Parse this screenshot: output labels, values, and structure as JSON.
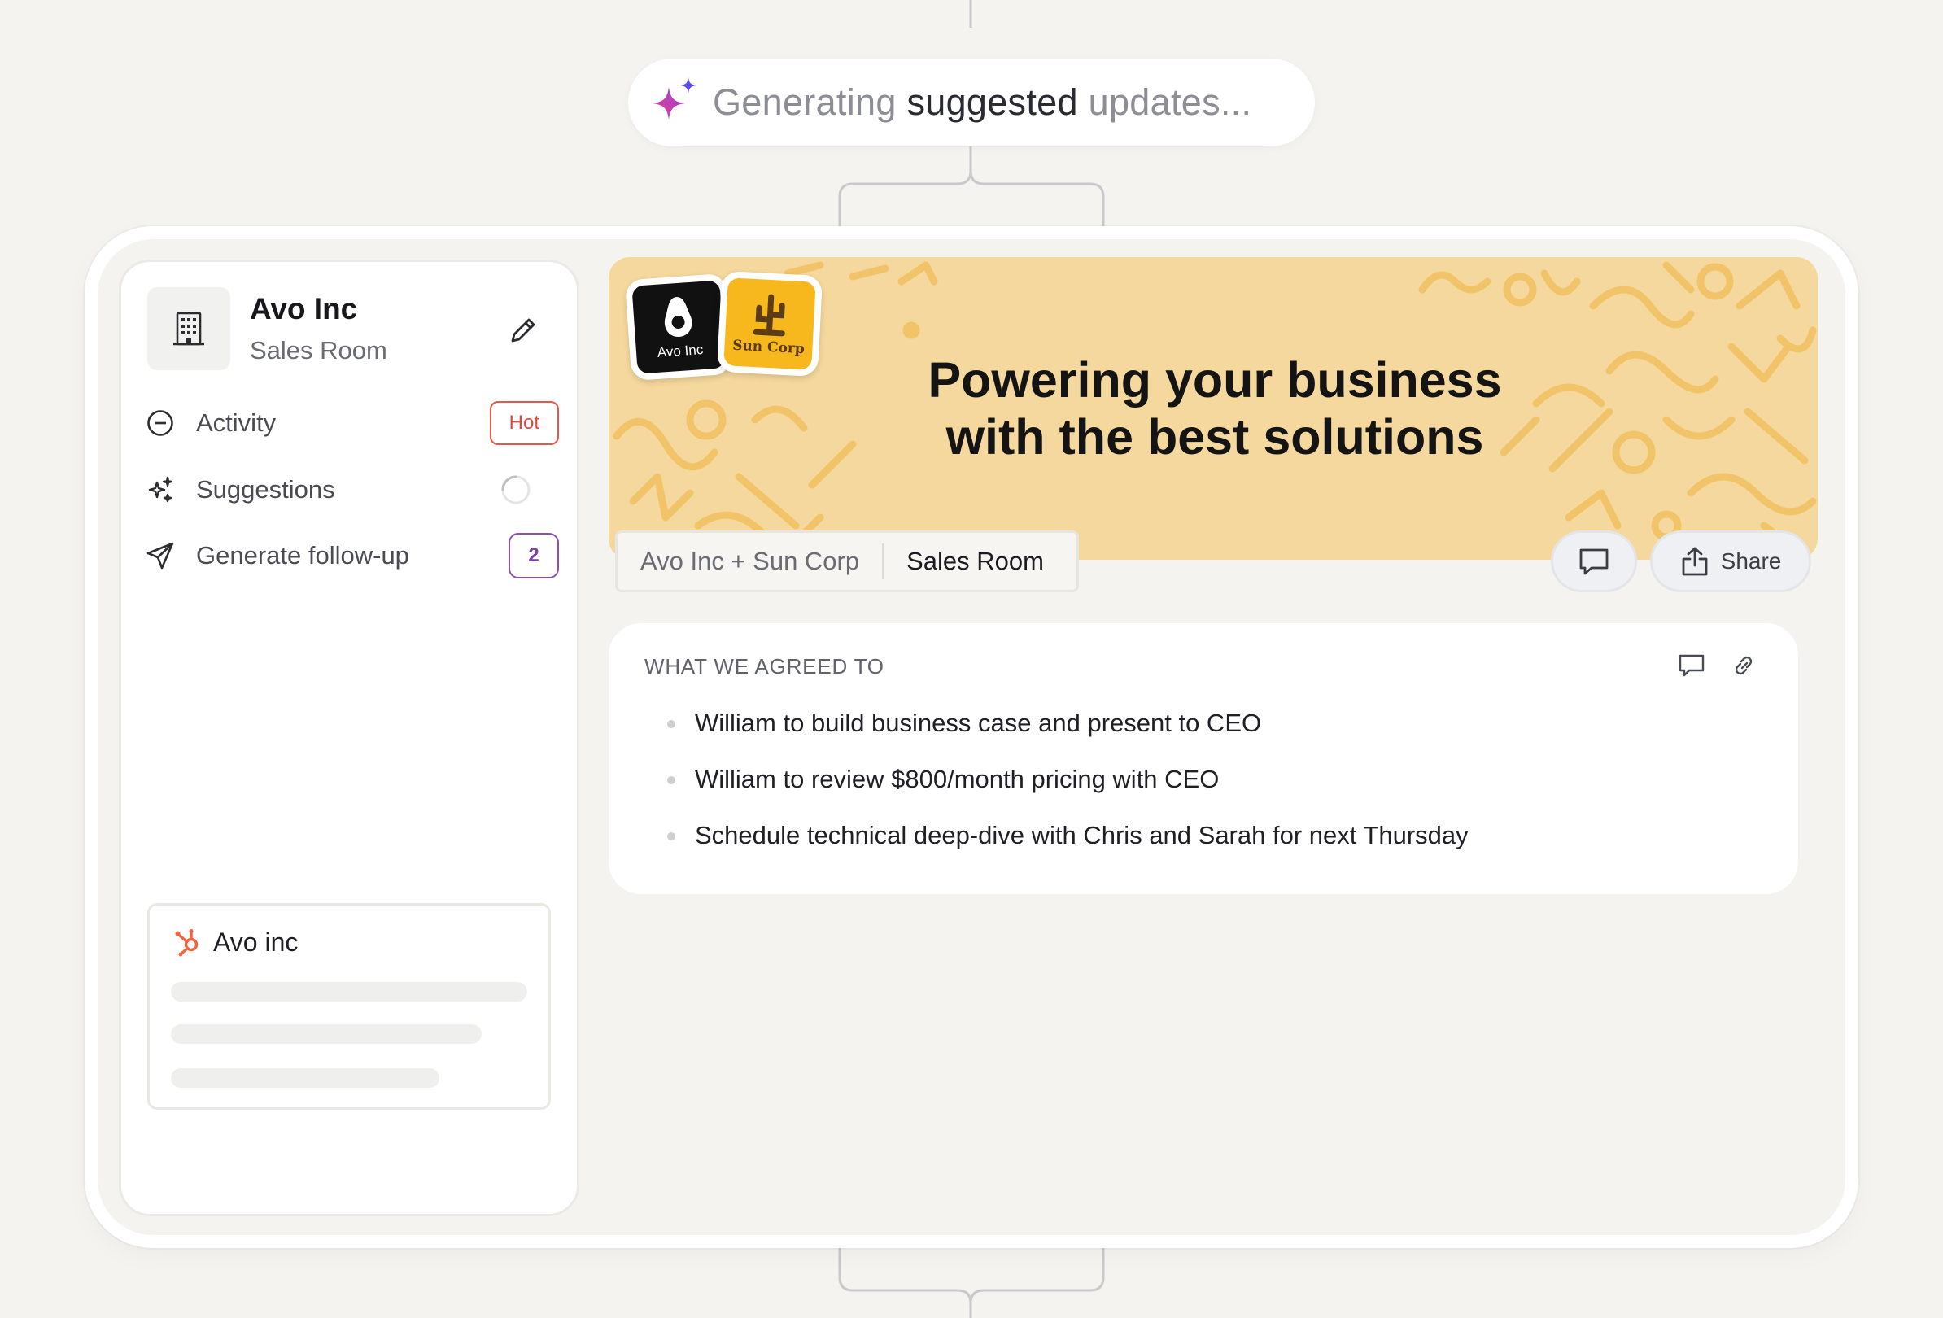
{
  "status": {
    "text_pre": "Generating ",
    "text_bold": "suggested",
    "text_post": " updates..."
  },
  "sidebar": {
    "company_name": "Avo Inc",
    "company_sub": "Sales Room",
    "items": [
      {
        "label": "Activity",
        "badge": "Hot",
        "icon": "minus-circle-icon"
      },
      {
        "label": "Suggestions",
        "icon": "sparkles-icon",
        "status": "loading"
      },
      {
        "label": "Generate follow-up",
        "badge": "2",
        "icon": "send-icon"
      }
    ],
    "crm_card": {
      "title": "Avo inc",
      "icon": "hubspot-icon"
    }
  },
  "banner": {
    "title": "Powering your business with the best solutions",
    "logos": [
      {
        "caption": "Avo Inc",
        "bg": "#111111"
      },
      {
        "caption": "Sun Corp",
        "bg": "#f7b81e"
      }
    ],
    "bg_color": "#f5d89d"
  },
  "breadcrumb": {
    "part1": "Avo Inc + Sun Corp",
    "part2": "Sales Room"
  },
  "actions": {
    "share_label": "Share"
  },
  "agreement": {
    "heading": "WHAT WE AGREED TO",
    "items": [
      "William to build business case and present to CEO",
      "William to review $800/month pricing with CEO",
      "Schedule technical deep-dive with Chris and Sarah for next Thursday"
    ]
  },
  "colors": {
    "accent_hot": "#e8584a",
    "accent_count": "#8b50b5",
    "background": "#f4f3ef"
  }
}
